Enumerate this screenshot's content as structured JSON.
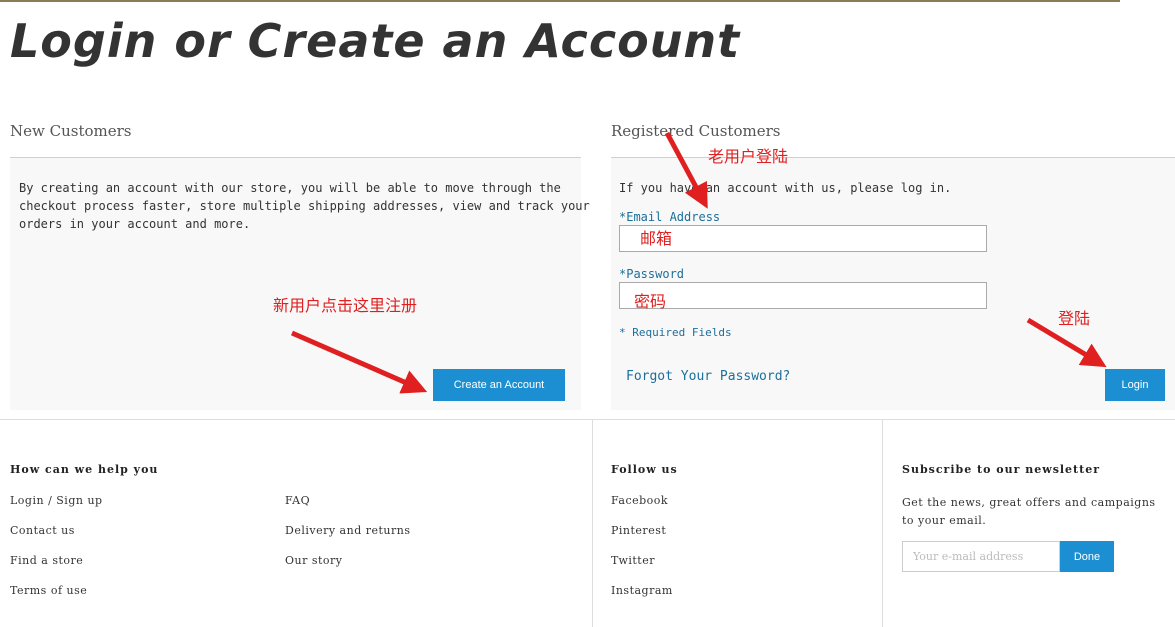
{
  "page": {
    "title": "Login or Create an Account"
  },
  "new_customers": {
    "heading": "New Customers",
    "description_lines": [
      "By creating an account with our store, you will be able to move through the",
      "checkout process faster, store multiple shipping addresses, view and track your",
      "orders in your account and more."
    ],
    "create_button": "Create an Account"
  },
  "registered": {
    "heading": "Registered Customers",
    "intro": "If you have an account with us, please log in.",
    "email_label": "*Email Address",
    "password_label": "*Password",
    "required_note": "* Required Fields",
    "forgot_link": "Forgot Your Password?",
    "login_button": "Login"
  },
  "annotations": {
    "old_user": "老用户登陆",
    "email": "邮箱",
    "password": "密码",
    "login": "登陆",
    "new_user": "新用户点击这里注册",
    "color": "#e02020"
  },
  "footer": {
    "help": {
      "heading": "How can we help you",
      "col1": [
        "Login / Sign up",
        "Contact us",
        "Find a store",
        "Terms of use"
      ],
      "col2": [
        "FAQ",
        "Delivery and returns",
        "Our story"
      ]
    },
    "follow": {
      "heading": "Follow us",
      "links": [
        "Facebook",
        "Pinterest",
        "Twitter",
        "Instagram"
      ]
    },
    "newsletter": {
      "heading": "Subscribe to our newsletter",
      "description": "Get the news, great offers and campaigns to your email.",
      "placeholder": "Your e-mail address",
      "button": "Done"
    }
  },
  "colors": {
    "accent": "#1b8fd2",
    "link": "#1b6f9a"
  }
}
